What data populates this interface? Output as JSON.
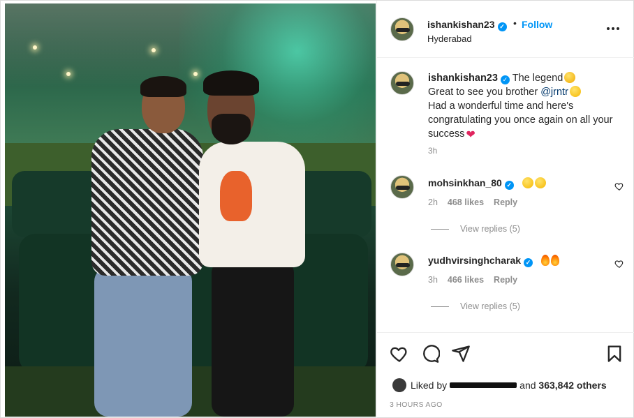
{
  "post": {
    "author": "ishankishan23",
    "follow_label": "Follow",
    "location": "Hyderabad",
    "dot": "•"
  },
  "caption": {
    "username": "ishankishan23",
    "line1": "The legend",
    "line2_prefix": "Great to see you brother ",
    "mention": "@jrntr",
    "line3": "Had a wonderful time and here's congratulating you once again on all your success",
    "time": "3h"
  },
  "comments": [
    {
      "username": "mohsinkhan_80",
      "time": "2h",
      "likes": "468 likes",
      "reply_label": "Reply",
      "view_replies": "View replies (5)",
      "emojis": [
        "star-struck",
        "star-struck"
      ]
    },
    {
      "username": "yudhvirsinghcharak",
      "time": "3h",
      "likes": "466 likes",
      "reply_label": "Reply",
      "view_replies": "View replies (5)",
      "emojis": [
        "fire",
        "fire"
      ]
    }
  ],
  "actions": {
    "liked_by_prefix": "Liked by",
    "and": "and",
    "others": "363,842 others",
    "timestamp": "3 HOURS AGO"
  },
  "icons": {
    "like": "heart-outline-icon",
    "comment": "comment-bubble-icon",
    "share": "paper-plane-icon",
    "save": "bookmark-icon",
    "more": "more-horizontal-icon",
    "verified": "verified-badge-icon"
  },
  "colors": {
    "link_blue": "#0095f6",
    "mention": "#00376b",
    "verified": "#0095f6",
    "secondary_text": "#8e8e8e",
    "border": "#dbdbdb"
  }
}
